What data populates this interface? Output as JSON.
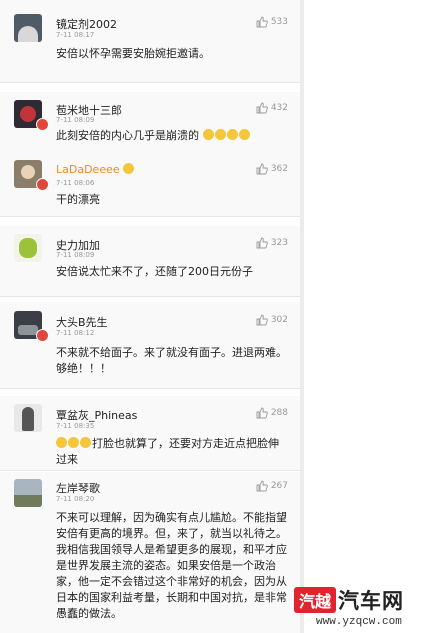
{
  "comments": [
    {
      "user": "镜定剂2002",
      "time": "7-11 08:17",
      "likes": "533",
      "text": "安倍以怀孕需要安胎婉拒邀请。"
    },
    {
      "user": "苞米地十三郎",
      "time": "7-11 08:09",
      "likes": "432",
      "text": "此刻安倍的内心几乎是崩溃的"
    },
    {
      "user": "LaDaDeeee",
      "time": "7-11 08:06",
      "likes": "362",
      "text": "干的漂亮"
    },
    {
      "user": "史力加加",
      "time": "7-11 08:09",
      "likes": "323",
      "text": "安倍说太忙来不了，还随了200日元份子"
    },
    {
      "user": "大头B先生",
      "time": "7-11 08:12",
      "likes": "302",
      "text": "不来就不给面子。来了就没有面子。进退两难。够绝！！！"
    },
    {
      "user": "覃盆灰_Phineas",
      "time": "7-11 08:35",
      "likes": "288",
      "text": "打脸也就算了，还要对方走近点把脸伸过来"
    },
    {
      "user": "左岸琴歌",
      "time": "7-11 08:20",
      "likes": "267",
      "text": "不来可以理解，因为确实有点儿尴尬。不能指望安倍有更高的境界。但，来了，就当以礼待之。我相信我国领导人是希望更多的展现，和平才应是世界发展主流的姿态。如果安倍是一个政治家，他一定不会错过这个非常好的机会，因为从日本的国家利益考量，长期和中国对抗，是非常愚蠢的做法。"
    }
  ],
  "watermark": {
    "logo": "汽越",
    "name": "汽车网",
    "url": "www.yzqcw.com"
  },
  "colors": {
    "orange_name": "#f08a23",
    "vip_badge": "#e0463b",
    "logo_red": "#e0232f"
  },
  "icons": [
    "thumb-up-icon",
    "vip-badge-icon",
    "emoji-face-icon"
  ]
}
